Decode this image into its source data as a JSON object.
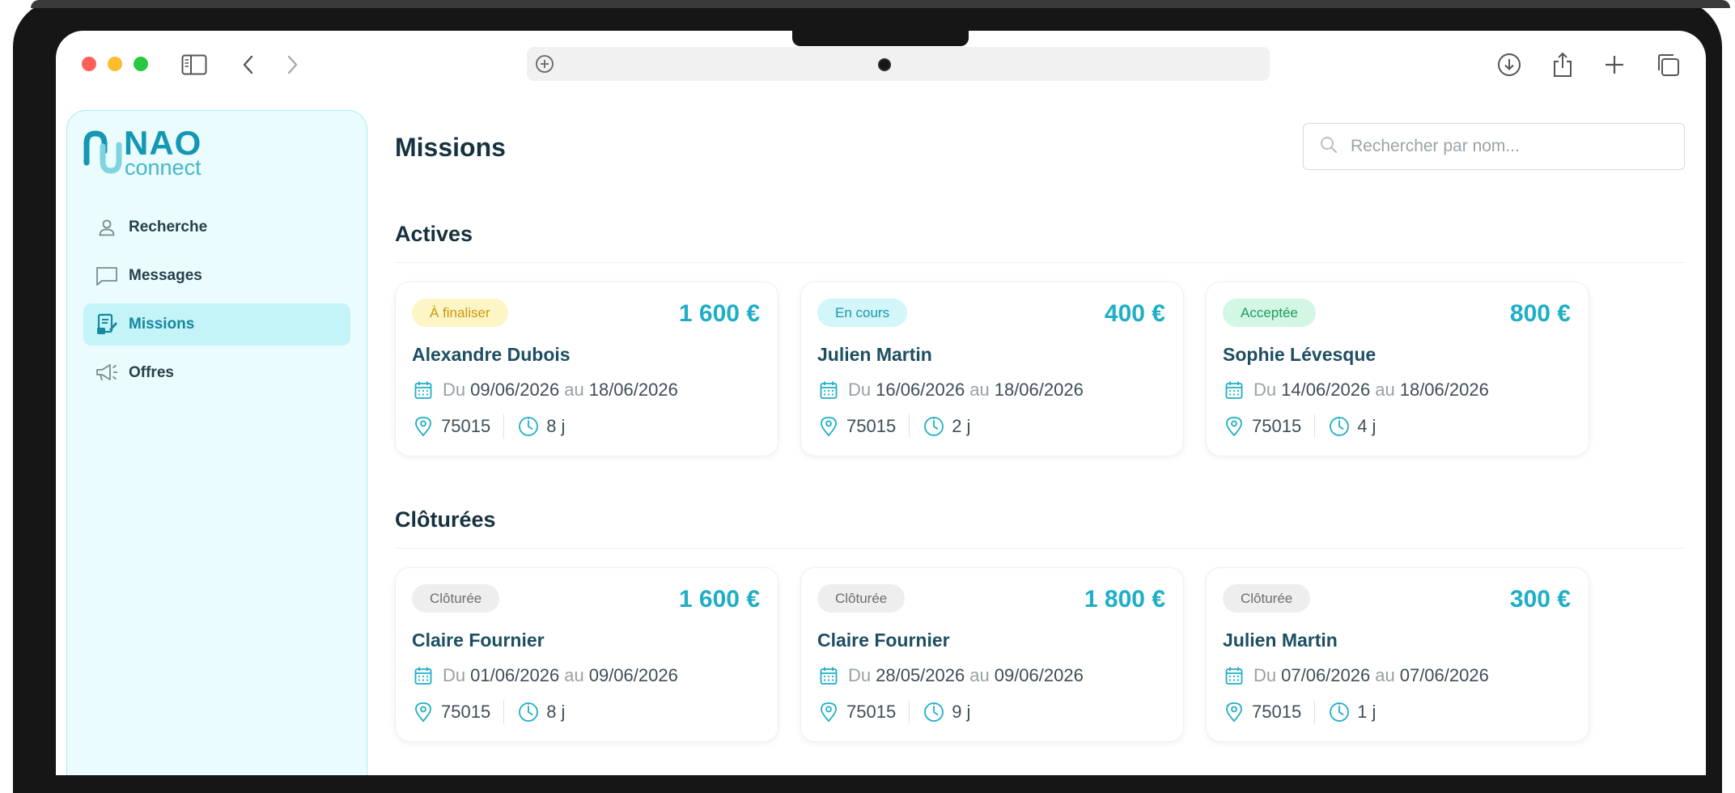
{
  "app": {
    "logo_name": "NAO",
    "logo_sub": "connect",
    "accent_color": "#1eaec6"
  },
  "sidebar": {
    "items": [
      {
        "label": "Recherche",
        "icon": "user-icon"
      },
      {
        "label": "Messages",
        "icon": "message-icon"
      },
      {
        "label": "Missions",
        "icon": "mission-document-icon",
        "active": true
      },
      {
        "label": "Offres",
        "icon": "megaphone-icon"
      }
    ]
  },
  "main": {
    "title": "Missions",
    "search_placeholder": "Rechercher par nom...",
    "sections": [
      {
        "title": "Actives",
        "cards": [
          {
            "status": "À finaliser",
            "status_color": "yellow",
            "price": "1 600 €",
            "name": "Alexandre Dubois",
            "date_prefix": "Du",
            "date_from": "09/06/2026",
            "date_mid": "au",
            "date_to": "18/06/2026",
            "postal": "75015",
            "duration": "8 j"
          },
          {
            "status": "En cours",
            "status_color": "cyan",
            "price": "400 €",
            "name": "Julien Martin",
            "date_prefix": "Du",
            "date_from": "16/06/2026",
            "date_mid": "au",
            "date_to": "18/06/2026",
            "postal": "75015",
            "duration": "2 j"
          },
          {
            "status": "Acceptée",
            "status_color": "green",
            "price": "800 €",
            "name": "Sophie Lévesque",
            "date_prefix": "Du",
            "date_from": "14/06/2026",
            "date_mid": "au",
            "date_to": "18/06/2026",
            "postal": "75015",
            "duration": "4 j"
          }
        ]
      },
      {
        "title": "Clôturées",
        "cards": [
          {
            "status": "Clôturée",
            "status_color": "grey",
            "price": "1 600 €",
            "name": "Claire Fournier",
            "date_prefix": "Du",
            "date_from": "01/06/2026",
            "date_mid": "au",
            "date_to": "09/06/2026",
            "postal": "75015",
            "duration": "8 j"
          },
          {
            "status": "Clôturée",
            "status_color": "grey",
            "price": "1 800 €",
            "name": "Claire Fournier",
            "date_prefix": "Du",
            "date_from": "28/05/2026",
            "date_mid": "au",
            "date_to": "09/06/2026",
            "postal": "75015",
            "duration": "9 j"
          },
          {
            "status": "Clôturée",
            "status_color": "grey",
            "price": "300 €",
            "name": "Julien Martin",
            "date_prefix": "Du",
            "date_from": "07/06/2026",
            "date_mid": "au",
            "date_to": "07/06/2026",
            "postal": "75015",
            "duration": "1 j"
          }
        ]
      }
    ]
  }
}
